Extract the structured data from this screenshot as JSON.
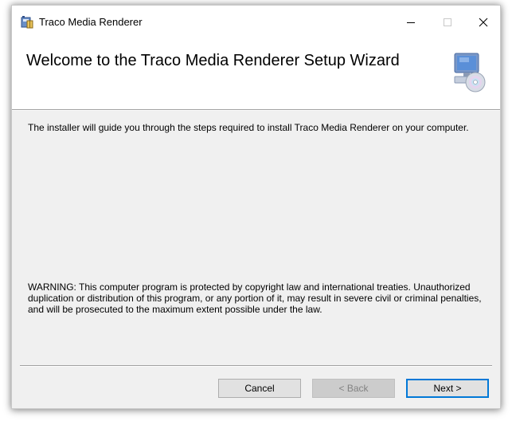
{
  "window": {
    "title": "Traco Media Renderer",
    "app_icon": "installer-package-icon",
    "controls": {
      "minimize_icon": "minimize-icon",
      "maximize_icon": "maximize-icon",
      "close_icon": "close-icon"
    }
  },
  "header": {
    "title": "Welcome to the Traco Media Renderer Setup Wizard",
    "art_icon": "computer-cd-icon"
  },
  "body": {
    "intro": "The installer will guide you through the steps required to install Traco Media Renderer on your computer.",
    "warning": "WARNING: This computer program is protected by copyright law and international treaties. Unauthorized duplication or distribution of this program, or any portion of it, may result in severe civil or criminal penalties, and will be prosecuted to the maximum extent possible under the law."
  },
  "buttons": {
    "cancel": "Cancel",
    "back": "< Back",
    "next": "Next >"
  },
  "colors": {
    "focus_border": "#0078d7",
    "dialog_background": "#f0f0f0"
  }
}
